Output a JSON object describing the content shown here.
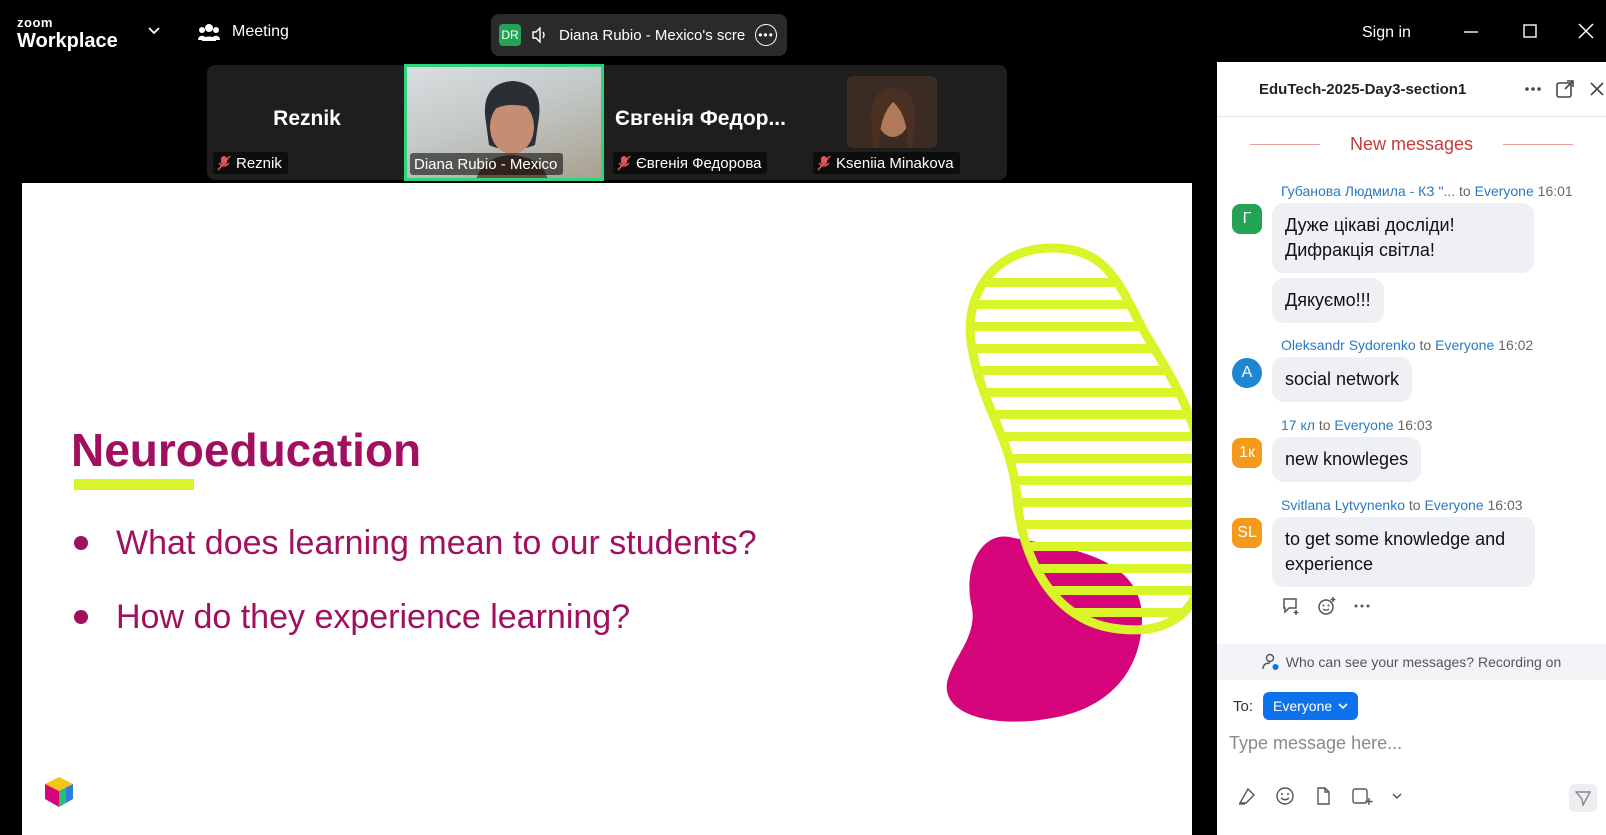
{
  "app": {
    "brand_top": "zoom",
    "brand_bottom": "Workplace",
    "meeting_label": "Meeting",
    "share_initials": "DR",
    "share_label": "Diana Rubio - Mexico's scre",
    "sign_in": "Sign in"
  },
  "participants": [
    {
      "big_name": "Reznik",
      "label": "Reznik",
      "muted": true
    },
    {
      "big_name": "",
      "label": "Diana Rubio - Mexico",
      "muted": false,
      "video": true
    },
    {
      "big_name": "Євгенія Федор...",
      "label": "Євгенія Федорова",
      "muted": true
    },
    {
      "big_name": "",
      "label": "Kseniia Minakova",
      "muted": true,
      "video": true
    }
  ],
  "slide": {
    "title": "Neuroeducation",
    "bullets": [
      "What does learning mean to our students?",
      "How do they experience learning?"
    ],
    "colors": {
      "title": "#a0105e",
      "accent": "#d9f52a",
      "blob": "#d6047a"
    }
  },
  "chat": {
    "title": "EduTech-2025-Day3-section1",
    "new_messages": "New messages",
    "messages": [
      {
        "avatar": "Г",
        "avatar_color": "#23a455",
        "sender": "Губанова Людмила - КЗ \"...",
        "to_word": "to",
        "to": "Everyone",
        "time": "16:01",
        "bubbles": [
          "Дуже цікаві досліди!\nДифракція світла!",
          "Дякуємо!!!"
        ]
      },
      {
        "avatar": "A",
        "avatar_color": "#1f86d1",
        "sender": "Oleksandr Sydorenko",
        "to_word": "to",
        "to": "Everyone",
        "time": "16:02",
        "bubbles": [
          "social network"
        ]
      },
      {
        "avatar": "1к",
        "avatar_color": "#f59a1b",
        "sender": "17 кл",
        "to_word": "to",
        "to": "Everyone",
        "time": "16:03",
        "bubbles": [
          "new knowleges"
        ]
      },
      {
        "avatar": "SL",
        "avatar_color": "#f59a1b",
        "sender": "Svitlana Lytvynenko",
        "to_word": "to",
        "to": "Everyone",
        "time": "16:03",
        "bubbles": [
          "to get some knowledge and\nexperience"
        ]
      }
    ],
    "privacy_text": "Who can see your messages? Recording on",
    "to_label": "To:",
    "to_value": "Everyone",
    "input_placeholder": "Type message here..."
  }
}
